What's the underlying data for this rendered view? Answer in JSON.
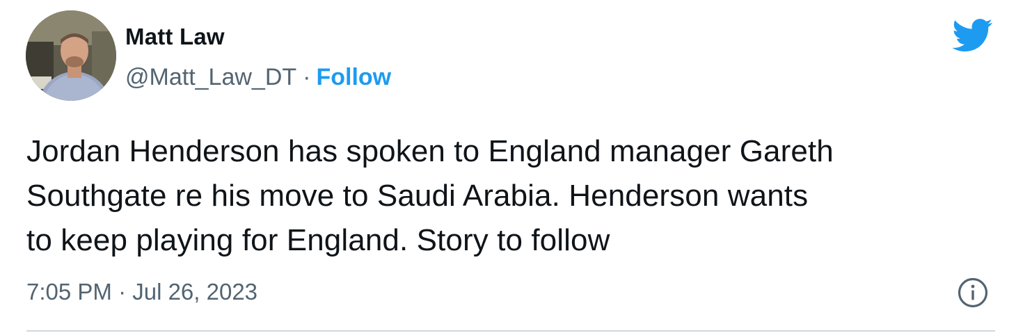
{
  "author": {
    "display_name": "Matt Law",
    "handle": "@Matt_Law_DT",
    "separator": "·",
    "follow_label": "Follow"
  },
  "tweet": {
    "text_lines": [
      "Jordan Henderson has spoken to England manager Gareth",
      "Southgate re his move to Saudi Arabia. Henderson wants",
      "to keep playing for England. Story to follow"
    ],
    "timestamp": "7:05 PM · Jul 26, 2023"
  },
  "icons": {
    "brand": "twitter-bird-icon",
    "info": "info-icon"
  },
  "colors": {
    "brand_blue": "#1d9bf0",
    "text_primary": "#0f1419",
    "text_secondary": "#536471",
    "divider": "#cfd9de"
  }
}
